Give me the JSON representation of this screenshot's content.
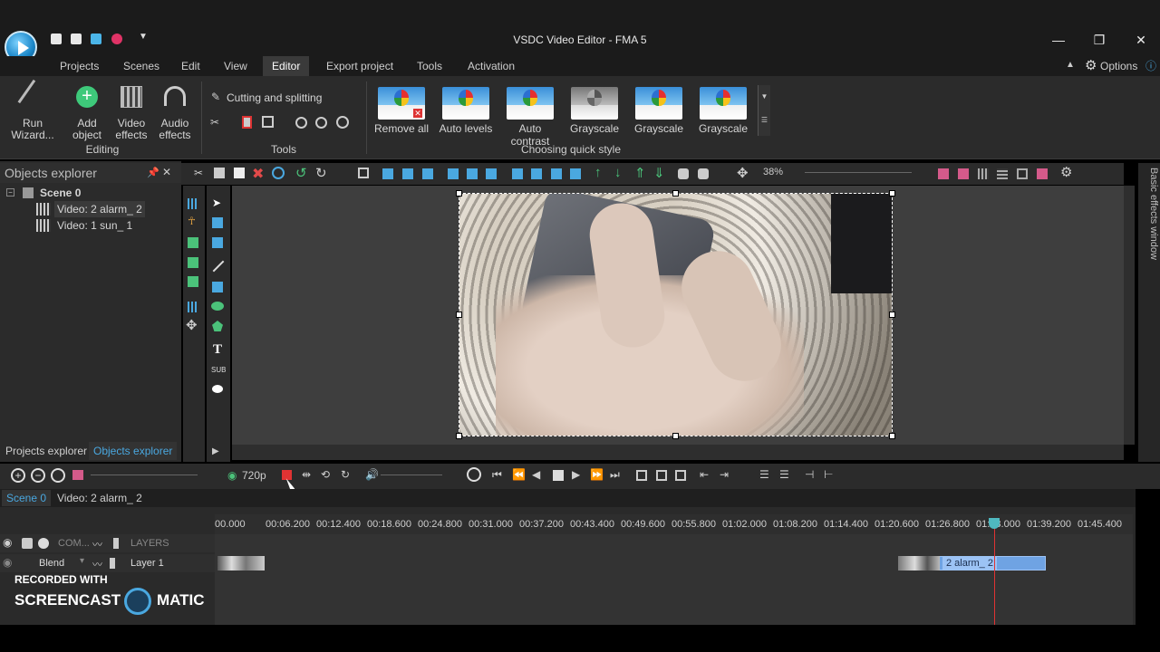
{
  "window": {
    "title": "VSDC Video Editor - FMA 5",
    "minimize": "—",
    "restore": "❐",
    "close": "✕"
  },
  "menu": {
    "items": [
      "Projects",
      "Scenes",
      "Edit",
      "View",
      "Editor",
      "Export project",
      "Tools",
      "Activation"
    ],
    "options": "Options",
    "help": "ⓘ"
  },
  "ribbon": {
    "run_wizard": "Run Wizard...",
    "add_object": "Add object",
    "video_effects": "Video effects",
    "audio_effects": "Audio effects",
    "editing": "Editing",
    "cutting": "Cutting and splitting",
    "tools": "Tools",
    "styles": [
      "Remove all",
      "Auto levels",
      "Auto contrast",
      "Grayscale",
      "Grayscale",
      "Grayscale"
    ],
    "choosing": "Choosing quick style"
  },
  "objects": {
    "header": "Objects explorer",
    "scene": "Scene 0",
    "items": [
      "Video: 2 alarm_ 2",
      "Video: 1 sun_ 1"
    ]
  },
  "canvas": {
    "zoom": "38%"
  },
  "side": {
    "label": "Basic effects window"
  },
  "bottom_tabs": [
    "Projects explorer",
    "Objects explorer"
  ],
  "timeline_bar": {
    "resolution": "720p"
  },
  "scene_tabs": [
    "Scene 0",
    "Video: 2 alarm_ 2"
  ],
  "ruler": [
    "00.000",
    "00:06.200",
    "00:12.400",
    "00:18.600",
    "00:24.800",
    "00:31.000",
    "00:37.200",
    "00:43.400",
    "00:49.600",
    "00:55.800",
    "01:02.000",
    "01:08.200",
    "01:14.400",
    "01:20.600",
    "01:26.800",
    "01:33.000",
    "01:39.200",
    "01:45.400"
  ],
  "tracks": {
    "com": "COM...",
    "layers": "LAYERS",
    "blend": "Blend",
    "layer1": "Layer 1",
    "clip": "2 alarm_ 2"
  },
  "watermark": {
    "recorded": "RECORDED WITH",
    "brand1": "SCREENCAST",
    "brand2": "MATIC"
  }
}
